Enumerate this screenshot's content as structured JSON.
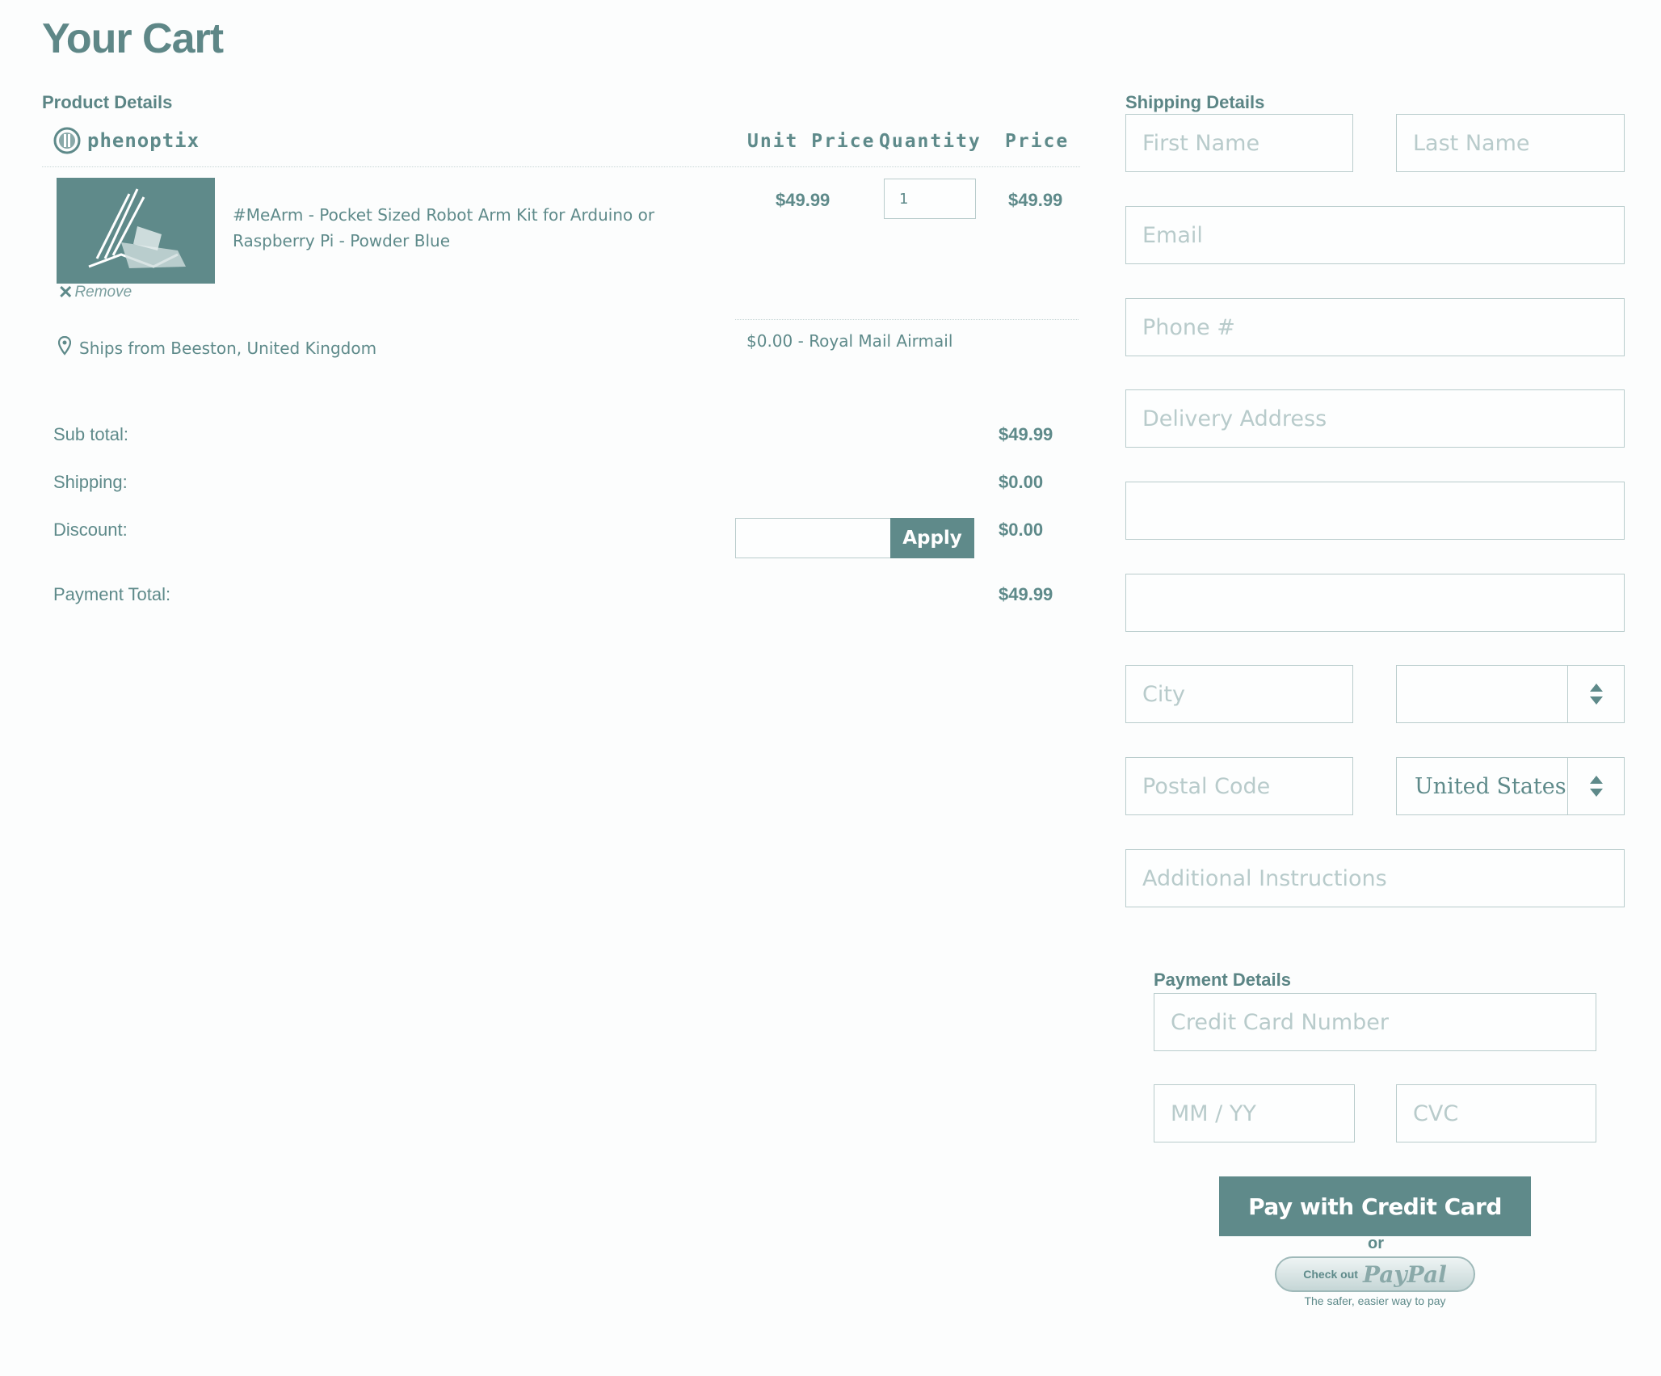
{
  "page": {
    "title": "Your Cart"
  },
  "product_section": {
    "label": "Product Details",
    "seller": "phenoptix",
    "columns": {
      "unit_price": "Unit Price",
      "quantity": "Quantity",
      "price": "Price"
    },
    "item": {
      "name": "#MeArm - Pocket Sized Robot Arm Kit for Arduino or Raspberry Pi - Powder Blue",
      "unit_price": "$49.99",
      "quantity": "1",
      "price": "$49.99",
      "remove_label": "Remove"
    },
    "ships_from": "Ships from Beeston, United Kingdom",
    "shipping_option": "$0.00 - Royal Mail Airmail"
  },
  "totals": {
    "subtotal_label": "Sub total:",
    "subtotal_value": "$49.99",
    "shipping_label": "Shipping:",
    "shipping_value": "$0.00",
    "discount_label": "Discount:",
    "discount_value": "$0.00",
    "discount_input_value": "",
    "apply_label": "Apply",
    "payment_total_label": "Payment Total:",
    "payment_total_value": "$49.99"
  },
  "shipping_section": {
    "label": "Shipping Details",
    "first_name_placeholder": "First Name",
    "last_name_placeholder": "Last Name",
    "email_placeholder": "Email",
    "phone_placeholder": "Phone #",
    "address_placeholder": "Delivery Address",
    "address2_placeholder": "",
    "address3_placeholder": "",
    "city_placeholder": "City",
    "state_value": "",
    "postal_placeholder": "Postal Code",
    "country_value": "United States",
    "instructions_placeholder": "Additional Instructions"
  },
  "payment_section": {
    "label": "Payment Details",
    "card_number_placeholder": "Credit Card Number",
    "expiry_placeholder": "MM / YY",
    "cvc_placeholder": "CVC",
    "pay_button_label": "Pay with Credit Card",
    "or_label": "or",
    "paypal_checkout_text": "Check out",
    "paypal_brand": "PayPal",
    "paypal_tagline": "The safer, easier way to pay"
  },
  "colors": {
    "accent": "#5f8a8a",
    "border": "#b9cccc",
    "placeholder": "#b8cbcb"
  },
  "icons": [
    "seller-logo-icon",
    "product-thumbnail",
    "remove-x-icon",
    "location-pin-icon",
    "select-updown-icon"
  ]
}
